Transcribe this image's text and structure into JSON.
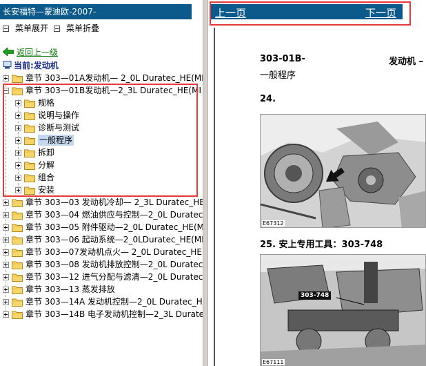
{
  "left_pane": {
    "title": "长安福特—蒙迪欧-2007-",
    "menu_expand": "菜单展开",
    "menu_collapse": "菜单折叠",
    "back_link": "返回上一级",
    "current": "当前:发动机",
    "tree": [
      {
        "label": "章节 303—01A发动机— 2_0L Duratec_HE(MI",
        "state": "collapsed",
        "level": 0
      },
      {
        "label": "章节 303—01B发动机—2_3L Duratec_HE(MI",
        "state": "expanded",
        "level": 0
      },
      {
        "label": "规格",
        "state": "collapsed",
        "level": 1
      },
      {
        "label": "说明与操作",
        "state": "collapsed",
        "level": 1
      },
      {
        "label": "诊断与测试",
        "state": "collapsed",
        "level": 1
      },
      {
        "label": "一般程序",
        "state": "collapsed",
        "level": 1,
        "selected": true
      },
      {
        "label": "拆卸",
        "state": "collapsed",
        "level": 1
      },
      {
        "label": "分解",
        "state": "collapsed",
        "level": 1
      },
      {
        "label": "组合",
        "state": "collapsed",
        "level": 1
      },
      {
        "label": "安装",
        "state": "collapsed",
        "level": 1
      },
      {
        "label": "章节 303—03 发动机冷却— 2_3L Duratec_HE",
        "state": "collapsed",
        "level": 0
      },
      {
        "label": "章节 303—04 燃油供应与控制—2_0L Duratec_",
        "state": "collapsed",
        "level": 0
      },
      {
        "label": "章节 303—05 附件驱动—2_0L Duratec_HE(M",
        "state": "collapsed",
        "level": 0
      },
      {
        "label": "章节 303—06 起动系统—2_0LDuratec_HE(MI",
        "state": "collapsed",
        "level": 0
      },
      {
        "label": "章节 303—07发动机点火— 2_0L Duratec_HE",
        "state": "collapsed",
        "level": 0
      },
      {
        "label": "章节 303—08 发动机排放控制—2_0L Duratec_",
        "state": "collapsed",
        "level": 0
      },
      {
        "label": "章节 303—12 进气分配与滤清—2_0L Duratec",
        "state": "collapsed",
        "level": 0
      },
      {
        "label": "章节 303—13 蒸发排放",
        "state": "collapsed",
        "level": 0
      },
      {
        "label": "章节 303—14A 发动机控制—2_0L Duratec_HE",
        "state": "collapsed",
        "level": 0
      },
      {
        "label": "章节 303—14B 电子发动机控制—2_3L Durate",
        "state": "collapsed",
        "level": 0
      }
    ]
  },
  "right_pane": {
    "prev": "上一页",
    "next": "下一页",
    "doc_code": "303-01B-",
    "doc_section": "发动机 –",
    "doc_subtitle": "一般程序",
    "step24": "24.",
    "fig1_label": "E67312",
    "step25": "25.  安上专用工具：303-748",
    "tool_tag": "303-748",
    "fig2_label": "E67111"
  },
  "colors": {
    "header_blue": "#0c5a8c",
    "highlight_red": "#e8393a",
    "link_green": "#0a7a0a",
    "current_blue": "#1a2b8c"
  }
}
